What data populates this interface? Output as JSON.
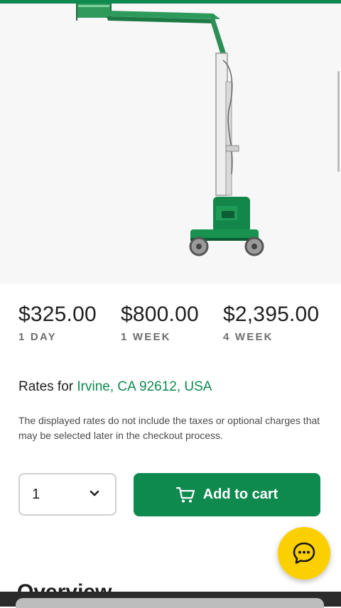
{
  "product": {
    "image_alt": "Green vertical mast boom lift"
  },
  "rates": [
    {
      "price": "$325.00",
      "period": "1 DAY"
    },
    {
      "price": "$800.00",
      "period": "1 WEEK"
    },
    {
      "price": "$2,395.00",
      "period": "4 WEEK"
    }
  ],
  "location": {
    "prefix": "Rates for",
    "link_text": "Irvine, CA 92612, USA"
  },
  "disclaimer": "The displayed rates do not include the taxes or optional charges that may be selected later in the checkout process.",
  "cart": {
    "quantity": "1",
    "add_label": "Add to cart"
  },
  "sections": {
    "overview_title": "Overview"
  },
  "icons": {
    "chevron": "chevron-down-icon",
    "cart": "cart-icon",
    "chat": "chat-icon"
  },
  "colors": {
    "brand_green": "#0e8a4f",
    "chat_yellow": "#fcd000"
  }
}
